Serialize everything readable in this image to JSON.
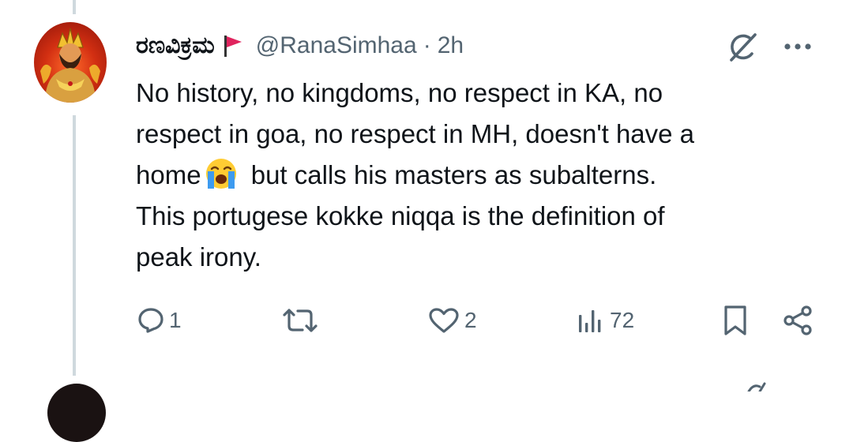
{
  "tweet": {
    "display_name": "ರಣವಿಕ್ರಮ",
    "flag_icon": "red-flag-icon",
    "handle": "@RanaSimhaa",
    "separator": "·",
    "time": "2h",
    "text_lines": [
      "No history, no kingdoms, no respect in KA, no",
      "respect in goa, no respect in MH, doesn't have a",
      "home",
      " but calls his masters as subalterns.",
      "This portugese kokke niqqa is the definition of",
      "peak irony."
    ],
    "emoji": "loudly-crying-face-emoji"
  },
  "actions": {
    "reply_count": "1",
    "retweet_count": "",
    "like_count": "2",
    "views_count": "72"
  },
  "colors": {
    "text": "#0f1419",
    "secondary": "#536471",
    "thread_line": "#cfd9de",
    "flag": "#e0245e"
  }
}
